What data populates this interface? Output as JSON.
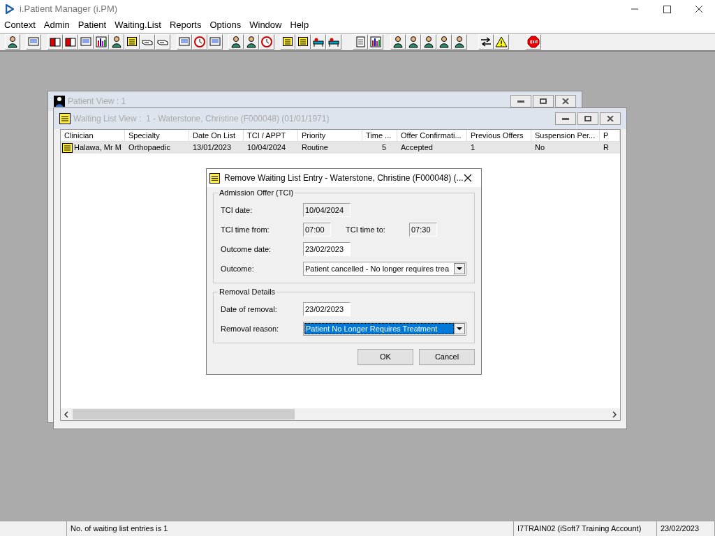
{
  "app": {
    "title": "i.Patient Manager (i.PM)",
    "menu": [
      "Context",
      "Admin",
      "Patient",
      "Waiting.List",
      "Reports",
      "Options",
      "Window",
      "Help"
    ]
  },
  "patient_view": {
    "title": "Patient View : 1"
  },
  "waiting_list_view": {
    "title": "Waiting List View :  1 - Waterstone, Christine (F000048) (01/01/1971)",
    "columns": [
      "Clinician",
      "Specialty",
      "Date On List",
      "TCI / APPT",
      "Priority",
      "Time ...",
      "Offer Confirmati...",
      "Previous Offers",
      "Suspension Per...",
      "P"
    ],
    "rows": [
      {
        "selected": true,
        "cells": [
          "Halawa, Mr M",
          "Orthopaedic",
          "13/01/2023",
          "10/04/2024",
          "Routine",
          "5",
          "Accepted",
          "1",
          "No",
          "R"
        ]
      }
    ]
  },
  "dialog": {
    "title": "Remove Waiting List Entry - Waterstone, Christine (F000048) (...",
    "groups": [
      {
        "legend": "Admission Offer (TCI)",
        "rows": [
          {
            "fields": [
              {
                "kind": "text",
                "label": "TCI date:",
                "value": "10/04/2024",
                "disabled": true
              }
            ]
          },
          {
            "fields": [
              {
                "kind": "short",
                "label": "TCI time from:",
                "value": "07:00",
                "disabled": true
              },
              {
                "kind": "short",
                "label": "TCI time to:",
                "value": "07:30",
                "disabled": true
              }
            ]
          },
          {
            "fields": [
              {
                "kind": "text",
                "label": "Outcome date:",
                "value": "23/02/2023",
                "disabled": false
              }
            ]
          },
          {
            "fields": [
              {
                "kind": "select",
                "label": "Outcome:",
                "value": "Patient cancelled - No longer requires trea",
                "disabled": false,
                "highlighted": false
              }
            ]
          }
        ]
      },
      {
        "legend": "Removal Details",
        "rows": [
          {
            "fields": [
              {
                "kind": "text",
                "label": "Date of removal:",
                "value": "23/02/2023",
                "disabled": false
              }
            ]
          },
          {
            "fields": [
              {
                "kind": "select",
                "label": "Removal reason:",
                "value": "Patient No Longer Requires Treatment",
                "disabled": false,
                "highlighted": true
              }
            ]
          }
        ]
      }
    ],
    "buttons": [
      "OK",
      "Cancel"
    ]
  },
  "status_bar": [
    "No. of waiting list entries is 1",
    "I7TRAIN02 (iSoft7 Training Account)",
    "23/02/2023"
  ]
}
